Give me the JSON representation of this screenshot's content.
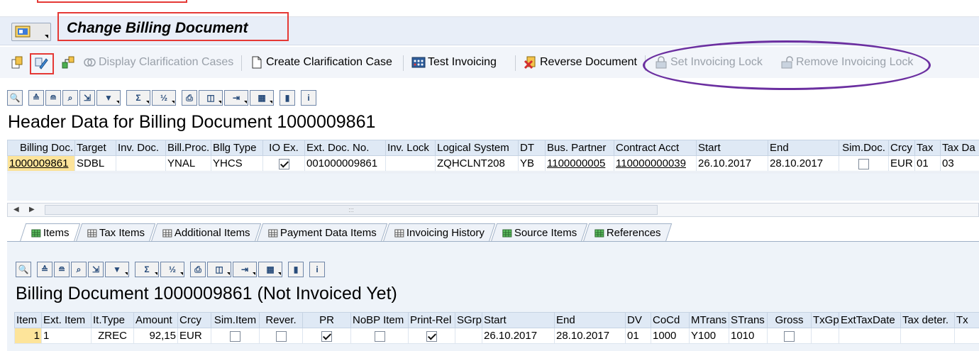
{
  "window": {
    "title": "Change Billing Document"
  },
  "app_toolbar": {
    "items": [
      {
        "icon": "other-object-icon",
        "label": ""
      },
      {
        "icon": "display-change-icon",
        "label": ""
      },
      {
        "icon": "document-flow-icon",
        "label": ""
      },
      {
        "icon": "display-clarification-icon",
        "label": "Display Clarification Cases",
        "enabled": false
      },
      {
        "icon": "new-document-icon",
        "label": "Create Clarification Case",
        "enabled": true
      },
      {
        "icon": "test-invoicing-icon",
        "label": "Test Invoicing",
        "enabled": true
      },
      {
        "icon": "reverse-icon",
        "label": "Reverse Document",
        "enabled": true
      },
      {
        "icon": "lock-icon",
        "label": "Set Invoicing Lock",
        "enabled": false
      },
      {
        "icon": "unlock-icon",
        "label": "Remove Invoicing Lock",
        "enabled": false
      }
    ]
  },
  "header_section": {
    "title": "Header Data for Billing Document 1000009861",
    "columns": [
      "Billing Doc.",
      "Target",
      "Inv. Doc.",
      "Bill.Proc.",
      "Bllg Type",
      "IO Ex.",
      "Ext. Doc. No.",
      "Inv. Lock",
      "Logical System",
      "DT",
      "Bus. Partner",
      "Contract Acct",
      "Start",
      "End",
      "Sim.Doc.",
      "Crcy",
      "Tax",
      "Tax Da"
    ],
    "row": {
      "billing_doc": "1000009861",
      "target": "SDBL",
      "inv_doc": "",
      "bill_proc": "YNAL",
      "bllg_type": "YHCS",
      "io_ex": true,
      "ext_doc_no": "001000009861",
      "inv_lock": "",
      "logical_system": "ZQHCLNT208",
      "dt": "YB",
      "bus_partner": "1100000005",
      "contract_acct": "110000000039",
      "start": "26.10.2017",
      "end": "28.10.2017",
      "sim_doc": false,
      "crcy": "EUR",
      "tax": "01",
      "tax_da": "03"
    }
  },
  "tabs": [
    {
      "label": "Items",
      "active": true
    },
    {
      "label": "Tax Items",
      "active": false
    },
    {
      "label": "Additional Items",
      "active": false
    },
    {
      "label": "Payment Data Items",
      "active": false
    },
    {
      "label": "Invoicing History",
      "active": false
    },
    {
      "label": "Source Items",
      "active": false
    },
    {
      "label": "References",
      "active": false
    }
  ],
  "items_section": {
    "title": "Billing Document 1000009861 (Not Invoiced Yet)",
    "columns": [
      "Item",
      "Ext. Item",
      "It.Type",
      "Amount",
      "Crcy",
      "Sim.Item",
      "Rever.",
      "PR",
      "NoBP Item",
      "Print-Rel",
      "SGrp",
      "Start",
      "End",
      "DV",
      "CoCd",
      "MTrans",
      "STrans",
      "Gross",
      "TxGp",
      "ExtTaxDate",
      "Tax deter.",
      "Tx"
    ],
    "row": {
      "item": "1",
      "ext_item": "1",
      "it_type": "ZREC",
      "amount": "92,15",
      "crcy": "EUR",
      "sim_item": false,
      "rever": false,
      "pr": true,
      "nobp_item": false,
      "print_rel": true,
      "sgrp": "",
      "start": "26.10.2017",
      "end": "28.10.2017",
      "dv": "01",
      "cocd": "1000",
      "mtrans": "Y100",
      "strans": "1010",
      "gross": false,
      "txgp": "",
      "exttaxdate": "",
      "tax_deter": "",
      "tx": ""
    }
  },
  "colors": {
    "highlight_red": "#e53935",
    "annotation_purple": "#6b2fa0",
    "selected_cell": "#fde49a",
    "header_bg": "#dfe9f5"
  }
}
